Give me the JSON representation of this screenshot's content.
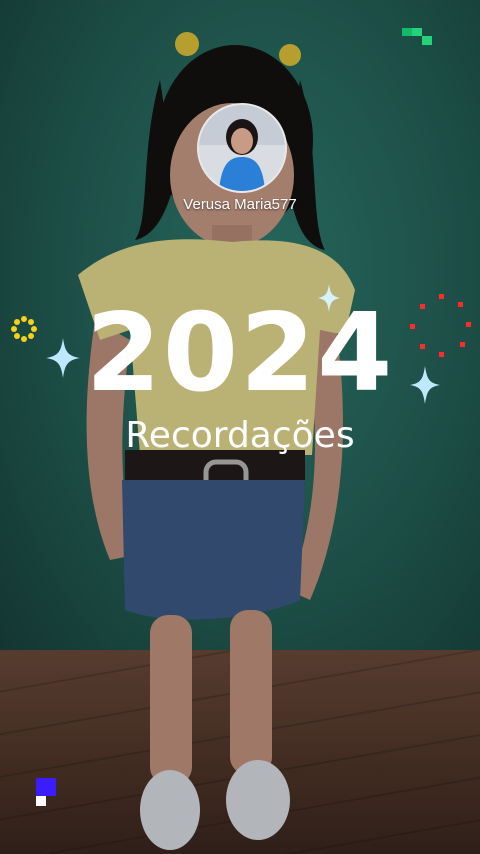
{
  "profile": {
    "username": "Verusa Maria577",
    "avatar_icon": "profile-photo"
  },
  "card": {
    "year": "2024",
    "subtitle": "Recordações"
  },
  "decorations": {
    "sparkle_color": "#bfe8ff",
    "burst_color": "#ff2a2a",
    "ring_color": "#f4d21a",
    "pixel_green": "#22d37a",
    "pixel_blue": "#3b1cff"
  }
}
